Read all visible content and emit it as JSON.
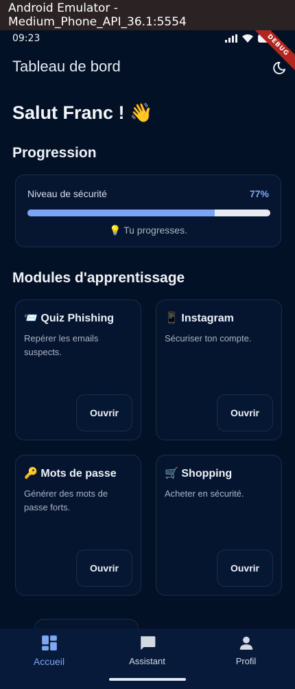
{
  "window": {
    "title": "Android Emulator - Medium_Phone_API_36.1:5554"
  },
  "status_bar": {
    "time": "09:23",
    "debug_label": "DEBUG"
  },
  "app_bar": {
    "title": "Tableau de bord",
    "theme_icon": "moon-icon"
  },
  "greeting": "Salut Franc ! 👋",
  "progress": {
    "section_title": "Progression",
    "label": "Niveau de sécurité",
    "percent_text": "77%",
    "value": 0.77,
    "tip": "💡 Tu progresses.",
    "fill_color": "#7aa5f6"
  },
  "modules": {
    "section_title": "Modules d'apprentissage",
    "items": [
      {
        "title": "📨 Quiz Phishing",
        "desc": "Repérer les emails suspects.",
        "button": "Ouvrir"
      },
      {
        "title": "📱 Instagram",
        "desc": "Sécuriser ton compte.",
        "button": "Ouvrir"
      },
      {
        "title": "🔑 Mots de passe",
        "desc": "Générer des mots de passe forts.",
        "button": "Ouvrir"
      },
      {
        "title": "🛒 Shopping",
        "desc": "Acheter en sécurité.",
        "button": "Ouvrir"
      }
    ]
  },
  "bottom_nav": {
    "active_color": "#7da8f5",
    "items": [
      {
        "label": "Accueil",
        "icon": "dashboard-icon",
        "active": true
      },
      {
        "label": "Assistant",
        "icon": "chat-icon",
        "active": false
      },
      {
        "label": "Profil",
        "icon": "person-icon",
        "active": false
      }
    ]
  }
}
